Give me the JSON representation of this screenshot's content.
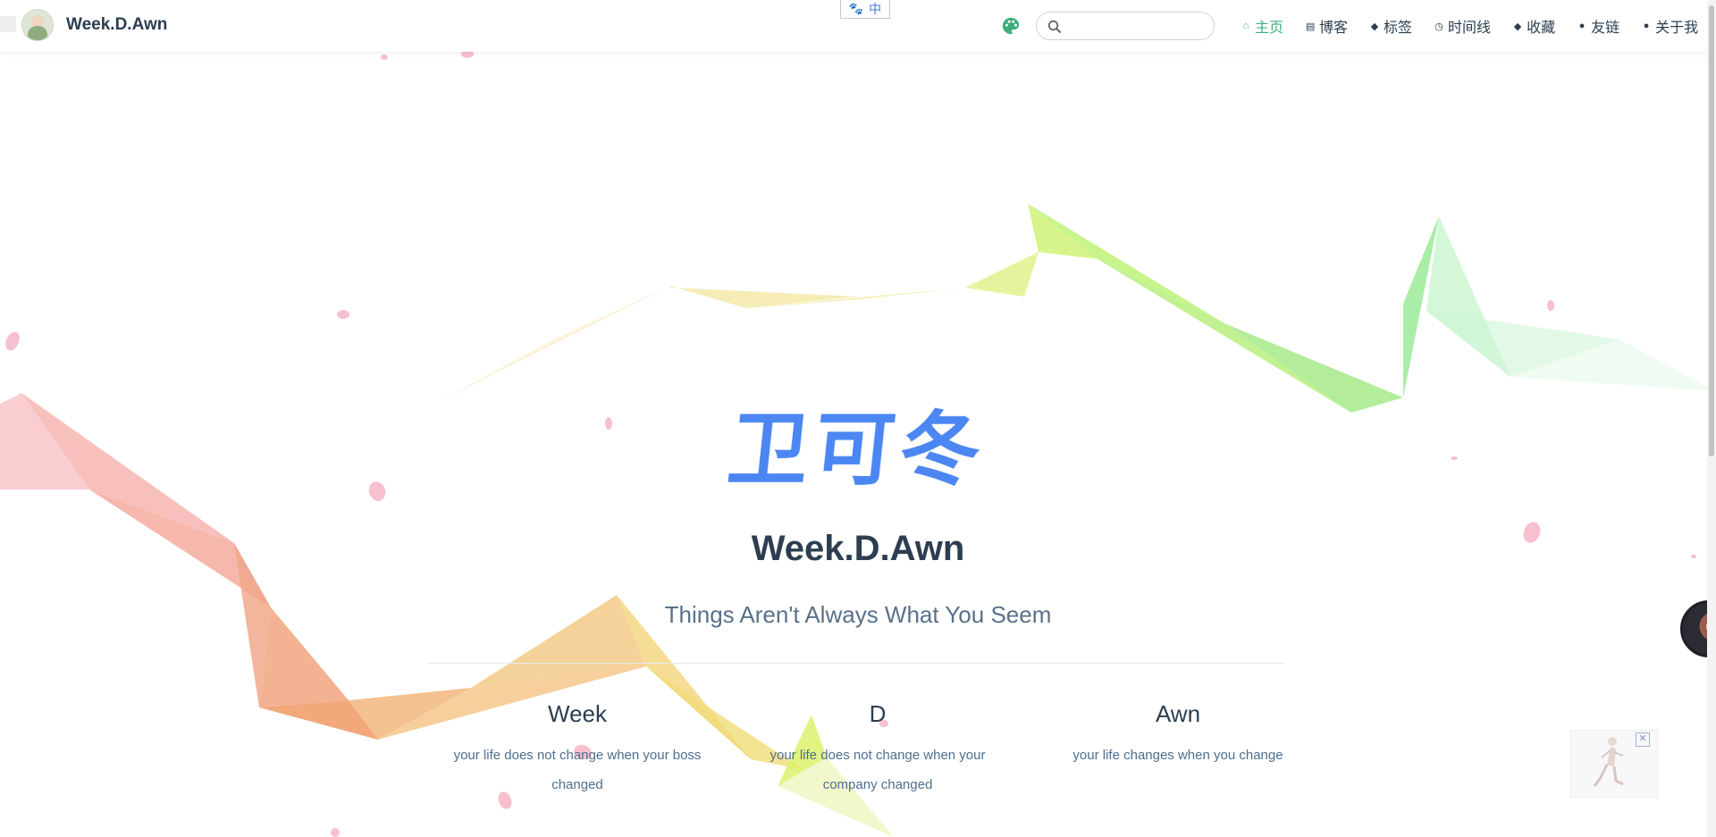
{
  "header": {
    "brand_title": "Week.D.Awn",
    "ime_label": "中",
    "search": {
      "value": "",
      "placeholder": ""
    },
    "nav": [
      {
        "label": "主页",
        "icon": "home-icon",
        "active": true
      },
      {
        "label": "博客",
        "icon": "document-icon",
        "active": false
      },
      {
        "label": "标签",
        "icon": "tag-icon",
        "active": false
      },
      {
        "label": "时间线",
        "icon": "clock-icon",
        "active": false
      },
      {
        "label": "收藏",
        "icon": "tag-icon",
        "active": false
      },
      {
        "label": "友链",
        "icon": "user-icon",
        "active": false
      },
      {
        "label": "关于我",
        "icon": "user-icon",
        "active": false
      }
    ],
    "accent_color": "#3eaf7c"
  },
  "hero": {
    "logo_text": "卫可冬",
    "title": "Week.D.Awn",
    "tagline": "Things Aren't Always What You Seem"
  },
  "features": [
    {
      "title": "Week",
      "details": "your life does not change when your boss changed"
    },
    {
      "title": "D",
      "details": "your life does not change when your company changed"
    },
    {
      "title": "Awn",
      "details": "your life changes when you change"
    }
  ],
  "colors": {
    "logo": "#4b86f2",
    "text": "#2c3e50",
    "tagline": "#5a7088"
  }
}
